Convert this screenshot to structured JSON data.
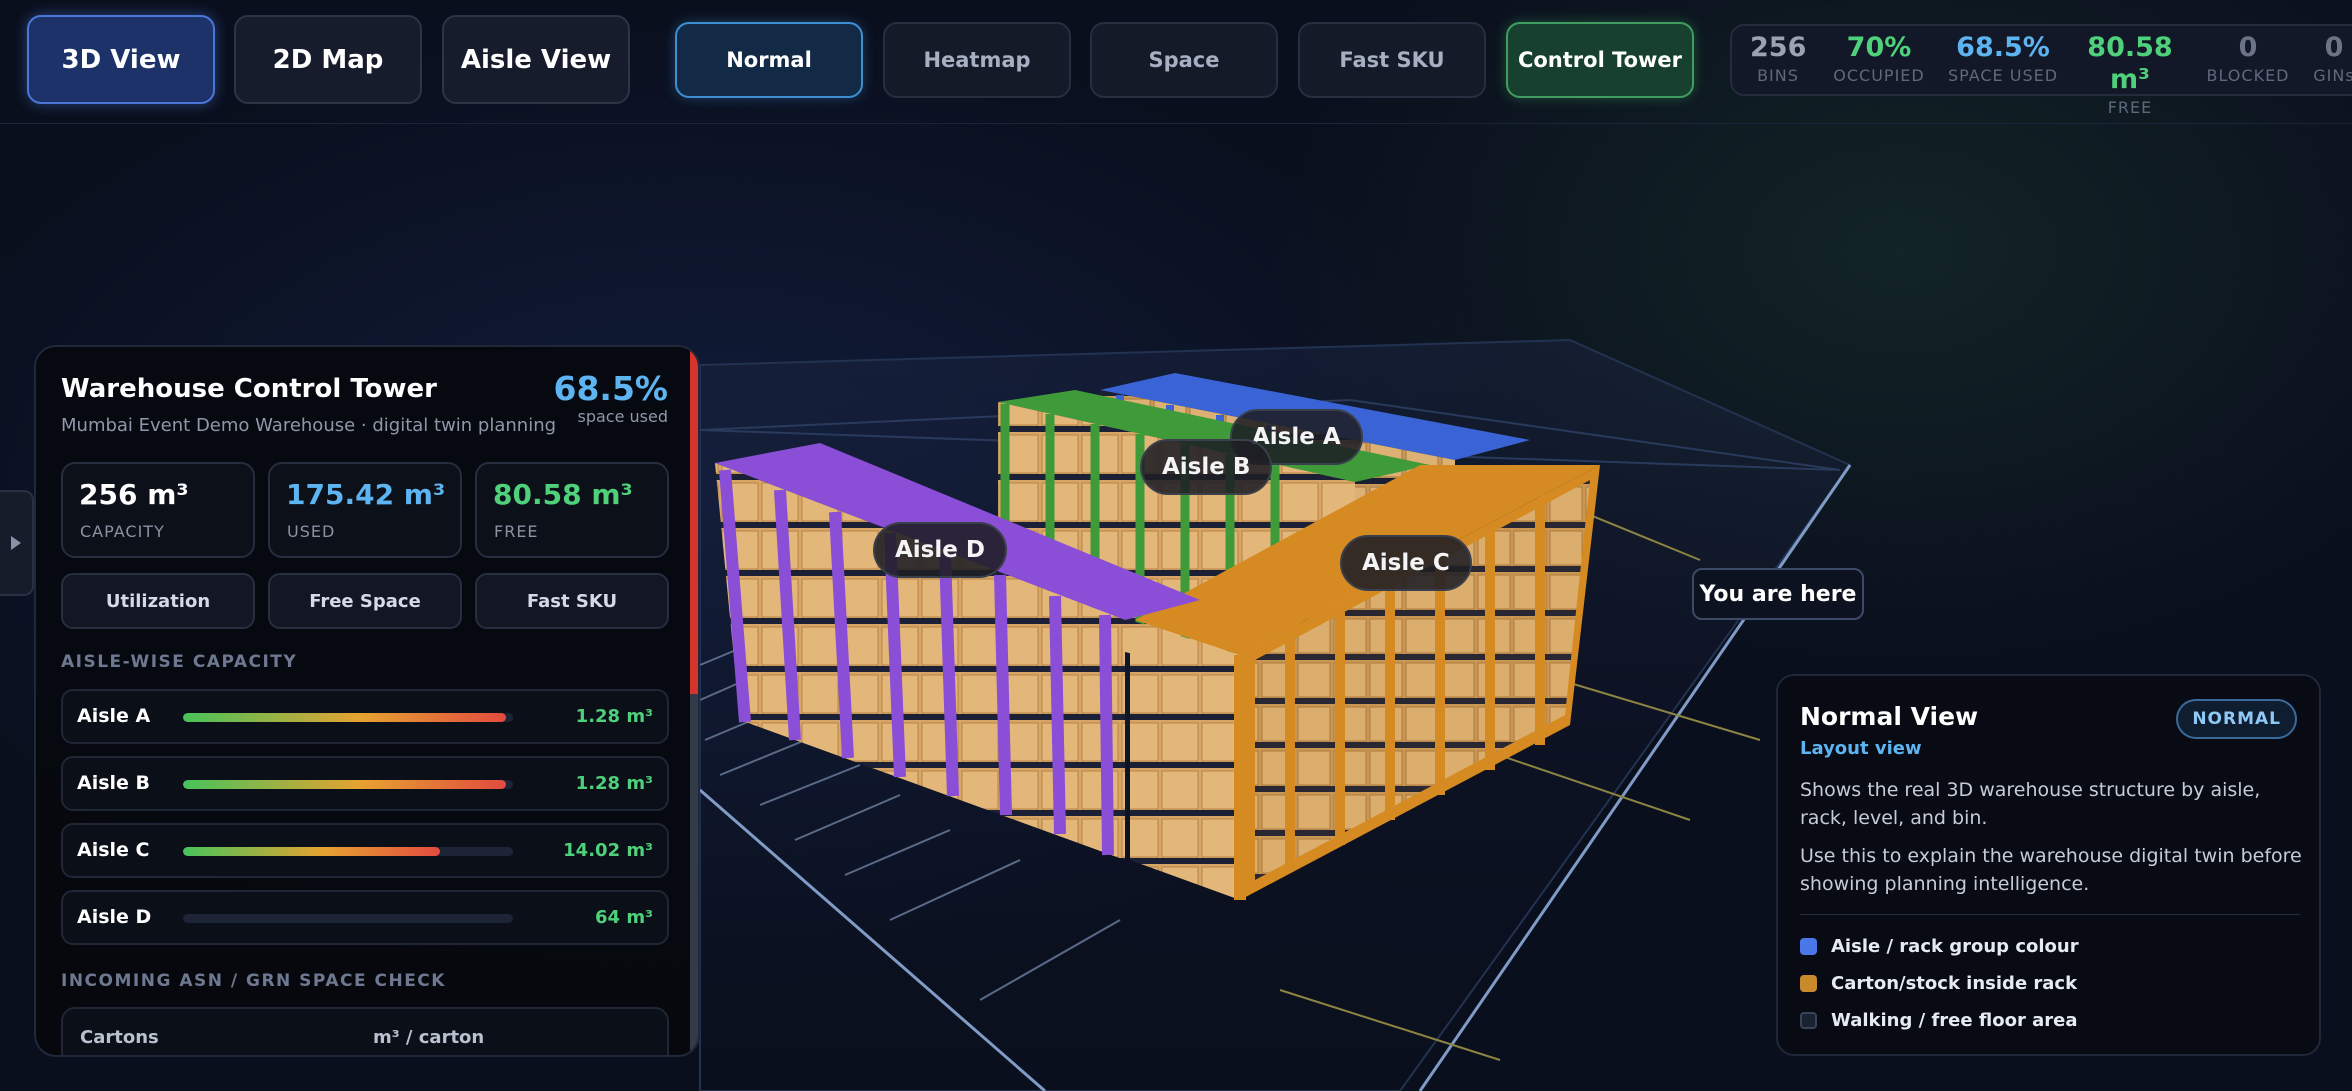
{
  "view_tabs": [
    "3D View",
    "2D Map",
    "Aisle View"
  ],
  "mode_tabs": [
    "Normal",
    "Heatmap",
    "Space",
    "Fast SKU",
    "Control Tower"
  ],
  "stats": [
    {
      "value": "256",
      "label": "BINS"
    },
    {
      "value": "70%",
      "label": "OCCUPIED"
    },
    {
      "value": "68.5%",
      "label": "SPACE USED"
    },
    {
      "value": "80.58 m³",
      "label": "FREE"
    },
    {
      "value": "0",
      "label": "BLOCKED"
    },
    {
      "value": "0",
      "label": "GINs"
    }
  ],
  "scene": {
    "aisle_labels": [
      "Aisle A",
      "Aisle B",
      "Aisle C",
      "Aisle D"
    ],
    "you_are_here": "You are here"
  },
  "panel": {
    "title": "Warehouse Control Tower",
    "subtitle": "Mumbai Event Demo Warehouse · digital twin planning",
    "space_used_value": "68.5%",
    "space_used_label": "space used",
    "metrics": [
      {
        "value": "256 m³",
        "label": "CAPACITY"
      },
      {
        "value": "175.42 m³",
        "label": "USED"
      },
      {
        "value": "80.58 m³",
        "label": "FREE"
      }
    ],
    "tabs": [
      "Utilization",
      "Free Space",
      "Fast SKU"
    ],
    "aisle_section_title": "AISLE-WISE CAPACITY",
    "aisles": [
      {
        "name": "Aisle A",
        "value": "1.28 m³",
        "fill_fraction": 0.98
      },
      {
        "name": "Aisle B",
        "value": "1.28 m³",
        "fill_fraction": 0.98
      },
      {
        "name": "Aisle C",
        "value": "14.02 m³",
        "fill_fraction": 0.78
      },
      {
        "name": "Aisle D",
        "value": "64 m³",
        "fill_fraction": 0
      }
    ],
    "asn_section_title": "INCOMING ASN / GRN SPACE CHECK",
    "table_headers": [
      "Cartons",
      "m³ / carton"
    ]
  },
  "info": {
    "title": "Normal View",
    "subtitle": "Layout view",
    "badge": "NORMAL",
    "para1": "Shows the real 3D warehouse structure by aisle, rack, level, and bin.",
    "para2": "Use this to explain the warehouse digital twin before showing planning intelligence.",
    "legend": [
      {
        "label": "Aisle / rack group colour",
        "color": "#4a78e8"
      },
      {
        "label": "Carton/stock inside rack",
        "color": "#c98a2c"
      },
      {
        "label": "Walking / free floor area",
        "color": "#1a2232"
      }
    ]
  },
  "colors": {
    "accent_blue": "#5db4f0",
    "accent_green": "#4fd07a",
    "aisle_a": "#3a64d6",
    "aisle_b": "#3f9b3a",
    "aisle_c": "#d68a22",
    "aisle_d": "#8a4fd6"
  }
}
